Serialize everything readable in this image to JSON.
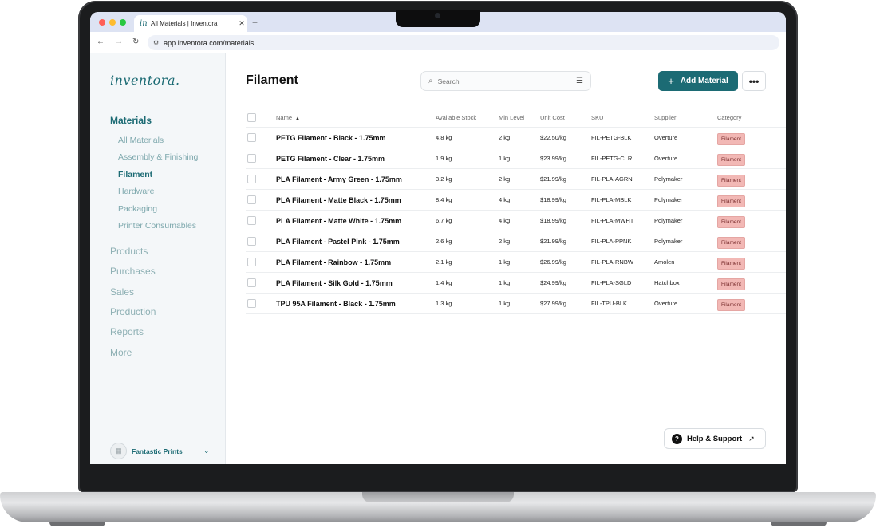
{
  "browser": {
    "tab_title": "All Materials | Inventora",
    "tab_favicon": "in",
    "url": "app.inventora.com/materials"
  },
  "sidebar": {
    "logo": "inventora.",
    "section": "Materials",
    "sub_items": [
      {
        "label": "All Materials",
        "active": false
      },
      {
        "label": "Assembly & Finishing",
        "active": false
      },
      {
        "label": "Filament",
        "active": true
      },
      {
        "label": "Hardware",
        "active": false
      },
      {
        "label": "Packaging",
        "active": false
      },
      {
        "label": "Printer Consumables",
        "active": false
      }
    ],
    "main_items": [
      "Products",
      "Purchases",
      "Sales",
      "Production",
      "Reports",
      "More"
    ],
    "workspace_name": "Fantastic Prints"
  },
  "header": {
    "title": "Filament",
    "search_placeholder": "Search",
    "add_label": "Add Material",
    "more_label": "•••"
  },
  "table": {
    "columns": {
      "name": "Name",
      "stock": "Available Stock",
      "min": "Min Level",
      "cost": "Unit Cost",
      "sku": "SKU",
      "supplier": "Supplier",
      "category": "Category"
    },
    "rows": [
      {
        "name": "PETG Filament - Black - 1.75mm",
        "stock": "4.8 kg",
        "min": "2 kg",
        "cost": "$22.50/kg",
        "sku": "FIL-PETG-BLK",
        "supplier": "Overture",
        "category": "Filament"
      },
      {
        "name": "PETG Filament - Clear - 1.75mm",
        "stock": "1.9 kg",
        "min": "1 kg",
        "cost": "$23.99/kg",
        "sku": "FIL-PETG-CLR",
        "supplier": "Overture",
        "category": "Filament"
      },
      {
        "name": "PLA Filament - Army Green - 1.75mm",
        "stock": "3.2 kg",
        "min": "2 kg",
        "cost": "$21.99/kg",
        "sku": "FIL-PLA-AGRN",
        "supplier": "Polymaker",
        "category": "Filament"
      },
      {
        "name": "PLA Filament - Matte Black - 1.75mm",
        "stock": "8.4 kg",
        "min": "4 kg",
        "cost": "$18.99/kg",
        "sku": "FIL-PLA-MBLK",
        "supplier": "Polymaker",
        "category": "Filament"
      },
      {
        "name": "PLA Filament - Matte White - 1.75mm",
        "stock": "6.7 kg",
        "min": "4 kg",
        "cost": "$18.99/kg",
        "sku": "FIL-PLA-MWHT",
        "supplier": "Polymaker",
        "category": "Filament"
      },
      {
        "name": "PLA Filament - Pastel Pink - 1.75mm",
        "stock": "2.6 kg",
        "min": "2 kg",
        "cost": "$21.99/kg",
        "sku": "FIL-PLA-PPNK",
        "supplier": "Polymaker",
        "category": "Filament"
      },
      {
        "name": "PLA Filament - Rainbow - 1.75mm",
        "stock": "2.1 kg",
        "min": "1 kg",
        "cost": "$26.99/kg",
        "sku": "FIL-PLA-RNBW",
        "supplier": "Amolen",
        "category": "Filament"
      },
      {
        "name": "PLA Filament - Silk Gold - 1.75mm",
        "stock": "1.4 kg",
        "min": "1 kg",
        "cost": "$24.99/kg",
        "sku": "FIL-PLA-SGLD",
        "supplier": "Hatchbox",
        "category": "Filament"
      },
      {
        "name": "TPU 95A Filament - Black - 1.75mm",
        "stock": "1.3 kg",
        "min": "1 kg",
        "cost": "$27.99/kg",
        "sku": "FIL-TPU-BLK",
        "supplier": "Overture",
        "category": "Filament"
      }
    ]
  },
  "help": {
    "label": "Help & Support"
  },
  "colors": {
    "brand": "#1c6b74",
    "badge_bg": "#f2b8b5"
  }
}
